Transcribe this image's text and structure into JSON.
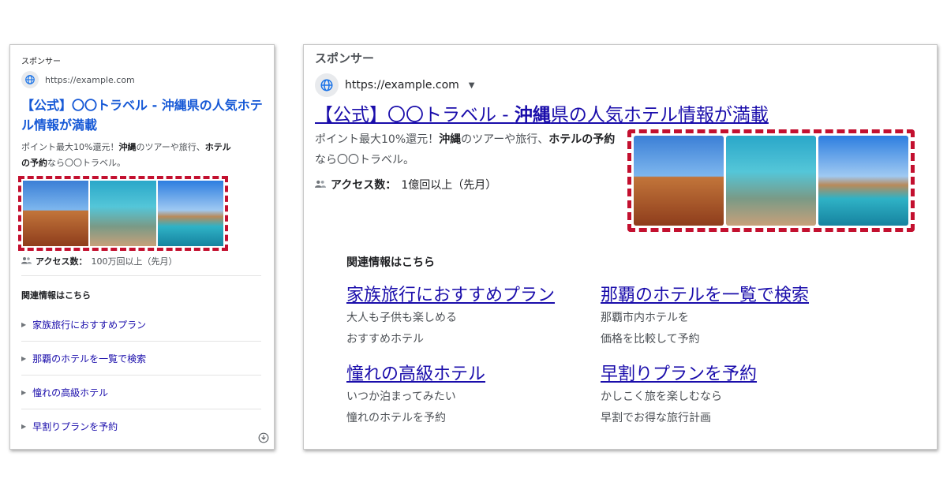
{
  "mobile": {
    "sponsor": "スポンサー",
    "url": "https://example.com",
    "title": "【公式】〇〇トラベル - 沖縄県の人気ホテル情報が満載",
    "desc_1": "ポイント最大10%還元！",
    "desc_bold_1": "沖縄",
    "desc_2": "のツアーや旅行、",
    "desc_bold_2": "ホテル",
    "desc_3": "の予約",
    "desc_4": "なら〇〇トラベル。",
    "access_label": "アクセス数：",
    "access_value": "100万回以上（先月）",
    "related_title": "関連情報はこちら",
    "sitelinks": [
      {
        "label": "家族旅行におすすめプラン"
      },
      {
        "label": "那覇のホテルを一覧で検索"
      },
      {
        "label": "憧れの高級ホテル"
      },
      {
        "label": "早割りプランを予約"
      }
    ]
  },
  "desktop": {
    "sponsor": "スポンサー",
    "url": "https://example.com",
    "title_1": "【公式】〇〇トラベル - ",
    "title_bold": "沖縄",
    "title_2": "県の人気ホテル情報が満載",
    "desc_1": "ポイント最大10%還元！",
    "desc_bold_1": "沖縄",
    "desc_2": "のツアーや旅行、",
    "desc_bold_2": "ホテル",
    "desc_3": "の予約",
    "desc_4": "なら〇〇トラベル。",
    "access_label": "アクセス数：",
    "access_value": "1億回以上（先月）",
    "related_title": "関連情報はこちら",
    "sitelinks": [
      {
        "title": "家族旅行におすすめプラン",
        "line1": "大人も子供も楽しめる",
        "line2": "おすすめホテル"
      },
      {
        "title": "那覇のホテルを一覧で検索",
        "line1": "那覇市内ホテルを",
        "line2": "価格を比較して予約"
      },
      {
        "title": "憧れの高級ホテル",
        "line1": "いつか泊まってみたい",
        "line2": "憧れのホテルを予約"
      },
      {
        "title": "早割りプランを予約",
        "line1": "かしこく旅を楽しむなら",
        "line2": "早割でお得な旅行計画"
      }
    ]
  },
  "images": [
    "shisa-statue-photo",
    "snorkel-turtle-photo",
    "overwater-villa-photo"
  ],
  "colors": {
    "link": "#1a0dab",
    "highlight_border": "#c3102f"
  }
}
